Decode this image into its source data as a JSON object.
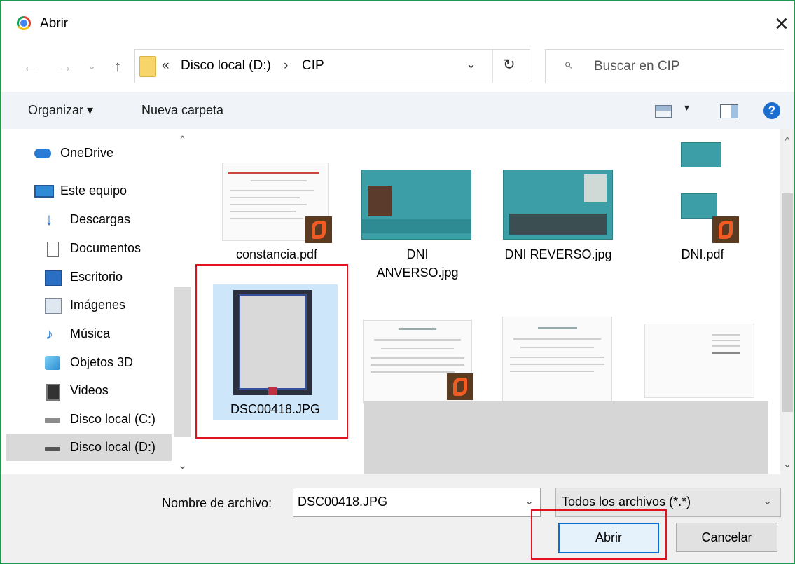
{
  "window": {
    "title": "Abrir",
    "close_glyph": "✕"
  },
  "nav": {
    "back": "←",
    "forward": "→",
    "recent": "⌄",
    "up": "↑"
  },
  "address": {
    "overflow": "«",
    "crumbs": [
      "Disco local (D:)",
      "CIP"
    ],
    "separator": "›",
    "dropdown_glyph": "⌄",
    "refresh_glyph": "↻"
  },
  "search": {
    "placeholder": "Buscar en CIP",
    "icon": "⌕"
  },
  "toolbar": {
    "organize": "Organizar ▾",
    "new_folder": "Nueva carpeta",
    "view_chevron": "▾",
    "help": "?"
  },
  "sidebar": {
    "items": [
      {
        "label": "OneDrive",
        "icon": "onedrive-icon"
      },
      {
        "label": "Este equipo",
        "icon": "pc-icon"
      },
      {
        "label": "Descargas",
        "icon": "downloads-icon"
      },
      {
        "label": "Documentos",
        "icon": "documents-icon"
      },
      {
        "label": "Escritorio",
        "icon": "desktop-icon"
      },
      {
        "label": "Imágenes",
        "icon": "pictures-icon"
      },
      {
        "label": "Música",
        "icon": "music-icon"
      },
      {
        "label": "Objetos 3D",
        "icon": "objects3d-icon"
      },
      {
        "label": "Videos",
        "icon": "videos-icon"
      },
      {
        "label": "Disco local (C:)",
        "icon": "drive-c-icon"
      },
      {
        "label": "Disco local (D:)",
        "icon": "drive-d-icon",
        "selected": true
      }
    ],
    "scroll_up": "^",
    "scroll_down": "⌄"
  },
  "files": {
    "row1": [
      {
        "name": "constancia.pdf",
        "type": "pdf"
      },
      {
        "name_line1": "DNI",
        "name_line2": "ANVERSO.jpg",
        "type": "jpg"
      },
      {
        "name": "DNI REVERSO.jpg",
        "type": "jpg"
      },
      {
        "name": "DNI.pdf",
        "type": "pdf"
      }
    ],
    "selected_file": {
      "name": "DSC00418.JPG",
      "type": "jpg"
    },
    "scroll_up": "^",
    "scroll_down": "⌄"
  },
  "bottom": {
    "filename_label": "Nombre de archivo:",
    "filename_value": "DSC00418.JPG",
    "filetype_value": "Todos los archivos (*.*)",
    "open_button": "Abrir",
    "cancel_button": "Cancelar",
    "chevron": "⌄"
  },
  "colors": {
    "selection": "#cde6fa",
    "highlight_box": "#e0141e",
    "pdf_icon": "#f05a23",
    "primary_border": "#0a6fd0",
    "window_border": "#1e9a4a"
  }
}
